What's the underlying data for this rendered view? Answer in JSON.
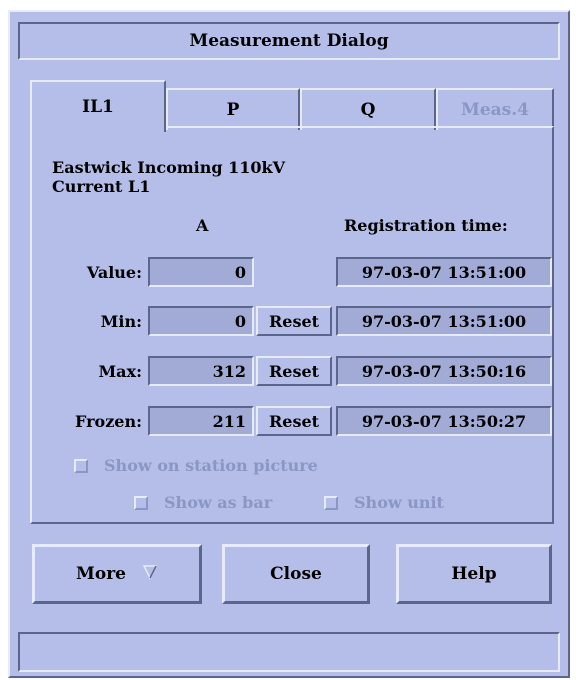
{
  "dialog": {
    "title": "Measurement Dialog"
  },
  "tabs": [
    {
      "label": "IL1",
      "active": true,
      "enabled": true
    },
    {
      "label": "P",
      "active": false,
      "enabled": true
    },
    {
      "label": "Q",
      "active": false,
      "enabled": true
    },
    {
      "label": "Meas.4",
      "active": false,
      "enabled": false
    }
  ],
  "object": {
    "station_line": "Eastwick  Incoming 110kV",
    "signal": "Current L1"
  },
  "columns": {
    "unit": "A",
    "registration_time": "Registration time:"
  },
  "rows": [
    {
      "label": "Value:",
      "value": "0",
      "reset": null,
      "time": "97-03-07 13:51:00"
    },
    {
      "label": "Min:",
      "value": "0",
      "reset": "Reset",
      "time": "97-03-07 13:51:00"
    },
    {
      "label": "Max:",
      "value": "312",
      "reset": "Reset",
      "time": "97-03-07 13:50:16"
    },
    {
      "label": "Frozen:",
      "value": "211",
      "reset": "Reset",
      "time": "97-03-07 13:50:27"
    }
  ],
  "options": {
    "show_on_station_picture": "Show on station picture",
    "show_as_bar": "Show as bar",
    "show_unit": "Show unit"
  },
  "buttons": {
    "more": "More",
    "more_icon": "triangle-down-icon",
    "close": "Close",
    "help": "Help"
  },
  "colors": {
    "background": "#b4bee8",
    "field": "#a1abd6",
    "disabled_text": "#8a96c4"
  }
}
